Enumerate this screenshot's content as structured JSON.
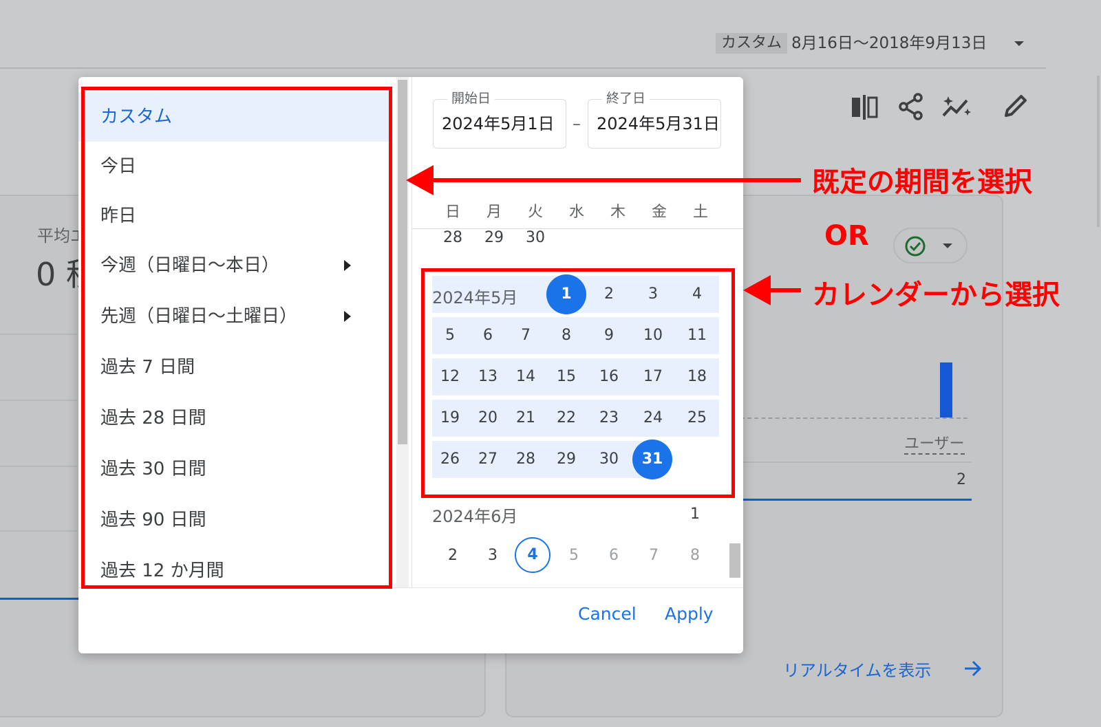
{
  "background": {
    "range_label": "カスタム",
    "range_text": "8月16日～2018年9月13日",
    "left_card_title": "平均エ",
    "left_card_value": "0 秒",
    "right_card_axis_label": "ユーザー",
    "right_card_value": "2",
    "realtime_link": "リアルタイムを表示",
    "toolbar_icons": [
      "compare-icon",
      "share-icon",
      "insights-icon",
      "edit-icon"
    ],
    "status_icon": "check-circle-icon"
  },
  "dialog": {
    "presets": [
      {
        "label": "カスタム",
        "selected": true,
        "submenu": false
      },
      {
        "label": "今日",
        "selected": false,
        "submenu": false
      },
      {
        "label": "昨日",
        "selected": false,
        "submenu": false
      },
      {
        "label": "今週（日曜日～本日）",
        "selected": false,
        "submenu": true
      },
      {
        "label": "先週（日曜日～土曜日）",
        "selected": false,
        "submenu": true
      },
      {
        "label": "過去 7 日間",
        "selected": false,
        "submenu": false
      },
      {
        "label": "過去 28 日間",
        "selected": false,
        "submenu": false
      },
      {
        "label": "過去 30 日間",
        "selected": false,
        "submenu": false
      },
      {
        "label": "過去 90 日間",
        "selected": false,
        "submenu": false
      },
      {
        "label": "過去 12 か月間",
        "selected": false,
        "submenu": false
      }
    ],
    "start_date": {
      "label": "開始日",
      "value": "2024年5月1日"
    },
    "end_date": {
      "label": "終了日",
      "value": "2024年5月31日"
    },
    "date_separator": "–",
    "weekdays": [
      "日",
      "月",
      "火",
      "水",
      "木",
      "金",
      "土"
    ],
    "april_tail": [
      "28",
      "29",
      "30"
    ],
    "may": {
      "label": "2024年5月",
      "weeks": [
        [
          "",
          "",
          "",
          "1",
          "2",
          "3",
          "4"
        ],
        [
          "5",
          "6",
          "7",
          "8",
          "9",
          "10",
          "11"
        ],
        [
          "12",
          "13",
          "14",
          "15",
          "16",
          "17",
          "18"
        ],
        [
          "19",
          "20",
          "21",
          "22",
          "23",
          "24",
          "25"
        ],
        [
          "26",
          "27",
          "28",
          "29",
          "30",
          "31",
          ""
        ]
      ],
      "range_start": "1",
      "range_end": "31"
    },
    "june": {
      "label": "2024年6月",
      "weeks": [
        [
          "",
          "",
          "",
          "",
          "",
          "",
          "1"
        ],
        [
          "2",
          "3",
          "4",
          "5",
          "6",
          "7",
          "8"
        ]
      ],
      "today": "4"
    },
    "cancel_label": "Cancel",
    "apply_label": "Apply"
  },
  "annotations": {
    "preset_note": "既定の期間を選択",
    "or_text": "OR",
    "calendar_note": "カレンダーから選択",
    "color": "#ff0000"
  },
  "colors": {
    "accent": "#1a73e8",
    "range_bg": "#e8f0fe",
    "chart_bar": "#1558d6"
  }
}
